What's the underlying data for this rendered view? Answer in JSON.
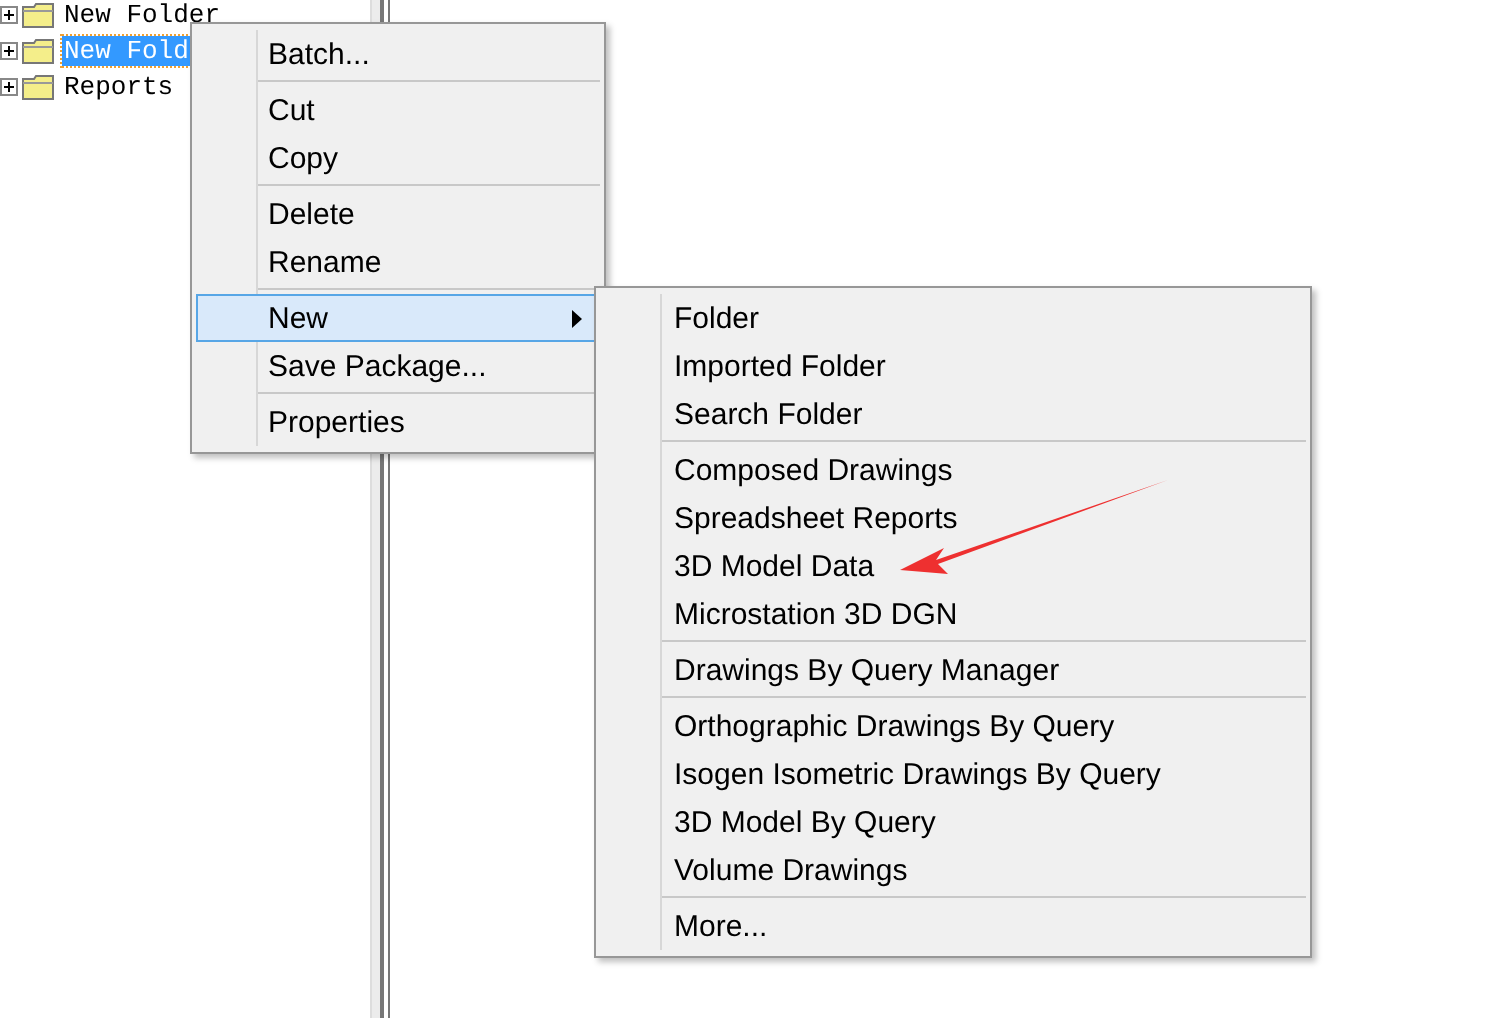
{
  "tree": {
    "items": [
      {
        "label": "New Folder",
        "selected": false
      },
      {
        "label": "New Fold",
        "selected": true
      },
      {
        "label": "Reports",
        "selected": false
      }
    ]
  },
  "context_menu": {
    "groups": [
      [
        {
          "label": "Batch...",
          "selected": false,
          "submenu": false
        }
      ],
      [
        {
          "label": "Cut",
          "selected": false,
          "submenu": false
        },
        {
          "label": "Copy",
          "selected": false,
          "submenu": false
        }
      ],
      [
        {
          "label": "Delete",
          "selected": false,
          "submenu": false
        },
        {
          "label": "Rename",
          "selected": false,
          "submenu": false
        }
      ],
      [
        {
          "label": "New",
          "selected": true,
          "submenu": true
        },
        {
          "label": "Save Package...",
          "selected": false,
          "submenu": false
        }
      ],
      [
        {
          "label": "Properties",
          "selected": false,
          "submenu": false
        }
      ]
    ]
  },
  "submenu": {
    "groups": [
      [
        {
          "label": "Folder",
          "selected": false
        },
        {
          "label": "Imported Folder",
          "selected": false
        },
        {
          "label": "Search Folder",
          "selected": false
        }
      ],
      [
        {
          "label": "Composed Drawings",
          "selected": false
        },
        {
          "label": "Spreadsheet Reports",
          "selected": false
        },
        {
          "label": "3D Model Data",
          "selected": false
        },
        {
          "label": "Microstation 3D DGN",
          "selected": false
        }
      ],
      [
        {
          "label": "Drawings By Query Manager",
          "selected": false
        }
      ],
      [
        {
          "label": "Orthographic Drawings By Query",
          "selected": false
        },
        {
          "label": "Isogen Isometric Drawings By Query",
          "selected": false
        },
        {
          "label": "3D Model By Query",
          "selected": false
        },
        {
          "label": "Volume Drawings",
          "selected": false
        }
      ],
      [
        {
          "label": "More...",
          "selected": false
        }
      ]
    ]
  }
}
